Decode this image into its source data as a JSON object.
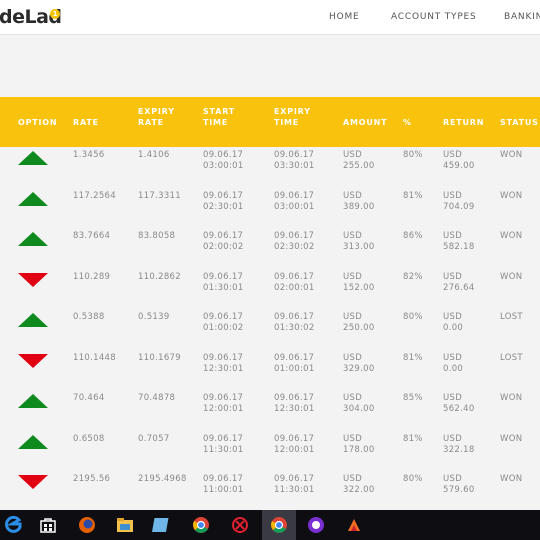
{
  "header": {
    "logo_text": "deLad",
    "logo_badge": "1",
    "nav": [
      "HOME",
      "ACCOUNT TYPES",
      "BANKIN"
    ]
  },
  "table": {
    "columns": [
      [
        "OPTION"
      ],
      [
        "RATE"
      ],
      [
        "EXPIRY",
        "RATE"
      ],
      [
        "START",
        "TIME"
      ],
      [
        "EXPIRY",
        "TIME"
      ],
      [
        "AMOUNT"
      ],
      [
        "%"
      ],
      [
        "RETURN"
      ],
      [
        "STATUS"
      ]
    ],
    "rows": [
      {
        "direction": "up",
        "rate": "1.3456",
        "expiry_rate": "1.4106",
        "start_date": "09.06.17",
        "start_time": "03:00:01",
        "expiry_date": "09.06.17",
        "expiry_time": "03:30:01",
        "currency": "USD",
        "amount": "255.00",
        "percent": "80%",
        "return_currency": "USD",
        "return": "459.00",
        "status": "WON"
      },
      {
        "direction": "up",
        "rate": "117.2564",
        "expiry_rate": "117.3311",
        "start_date": "09.06.17",
        "start_time": "02:30:01",
        "expiry_date": "09.06.17",
        "expiry_time": "03:00:01",
        "currency": "USD",
        "amount": "389.00",
        "percent": "81%",
        "return_currency": "USD",
        "return": "704.09",
        "status": "WON"
      },
      {
        "direction": "up",
        "rate": "83.7664",
        "expiry_rate": "83.8058",
        "start_date": "09.06.17",
        "start_time": "02:00:02",
        "expiry_date": "09.06.17",
        "expiry_time": "02:30:02",
        "currency": "USD",
        "amount": "313.00",
        "percent": "86%",
        "return_currency": "USD",
        "return": "582.18",
        "status": "WON"
      },
      {
        "direction": "down",
        "rate": "110.289",
        "expiry_rate": "110.2862",
        "start_date": "09.06.17",
        "start_time": "01:30:01",
        "expiry_date": "09.06.17",
        "expiry_time": "02:00:01",
        "currency": "USD",
        "amount": "152.00",
        "percent": "82%",
        "return_currency": "USD",
        "return": "276.64",
        "status": "WON"
      },
      {
        "direction": "up",
        "rate": "0.5388",
        "expiry_rate": "0.5139",
        "start_date": "09.06.17",
        "start_time": "01:00:02",
        "expiry_date": "09.06.17",
        "expiry_time": "01:30:02",
        "currency": "USD",
        "amount": "250.00",
        "percent": "80%",
        "return_currency": "USD",
        "return": "0.00",
        "status": "LOST"
      },
      {
        "direction": "down",
        "rate": "110.1448",
        "expiry_rate": "110.1679",
        "start_date": "09.06.17",
        "start_time": "12:30:01",
        "expiry_date": "09.06.17",
        "expiry_time": "01:00:01",
        "currency": "USD",
        "amount": "329.00",
        "percent": "81%",
        "return_currency": "USD",
        "return": "0.00",
        "status": "LOST"
      },
      {
        "direction": "up",
        "rate": "70.464",
        "expiry_rate": "70.4878",
        "start_date": "09.06.17",
        "start_time": "12:00:01",
        "expiry_date": "09.06.17",
        "expiry_time": "12:30:01",
        "currency": "USD",
        "amount": "304.00",
        "percent": "85%",
        "return_currency": "USD",
        "return": "562.40",
        "status": "WON"
      },
      {
        "direction": "up",
        "rate": "0.6508",
        "expiry_rate": "0.7057",
        "start_date": "09.06.17",
        "start_time": "11:30:01",
        "expiry_date": "09.06.17",
        "expiry_time": "12:00:01",
        "currency": "USD",
        "amount": "178.00",
        "percent": "81%",
        "return_currency": "USD",
        "return": "322.18",
        "status": "WON"
      },
      {
        "direction": "down",
        "rate": "2195.56",
        "expiry_rate": "2195.4968",
        "start_date": "09.06.17",
        "start_time": "11:00:01",
        "expiry_date": "09.06.17",
        "expiry_time": "11:30:01",
        "currency": "USD",
        "amount": "322.00",
        "percent": "80%",
        "return_currency": "USD",
        "return": "579.60",
        "status": "WON"
      }
    ]
  },
  "colors": {
    "header_bg": "#f9c20c",
    "up_arrow": "#0f8a1e",
    "down_arrow": "#e00012",
    "taskbar": "#0d0d12"
  },
  "taskbar": {
    "icons": [
      "edge-icon",
      "store-icon",
      "firefox-icon",
      "file-explorer-icon",
      "app-icon",
      "chrome-icon",
      "app-red-icon",
      "chrome-active-icon",
      "messenger-icon",
      "app-orange-icon"
    ]
  }
}
